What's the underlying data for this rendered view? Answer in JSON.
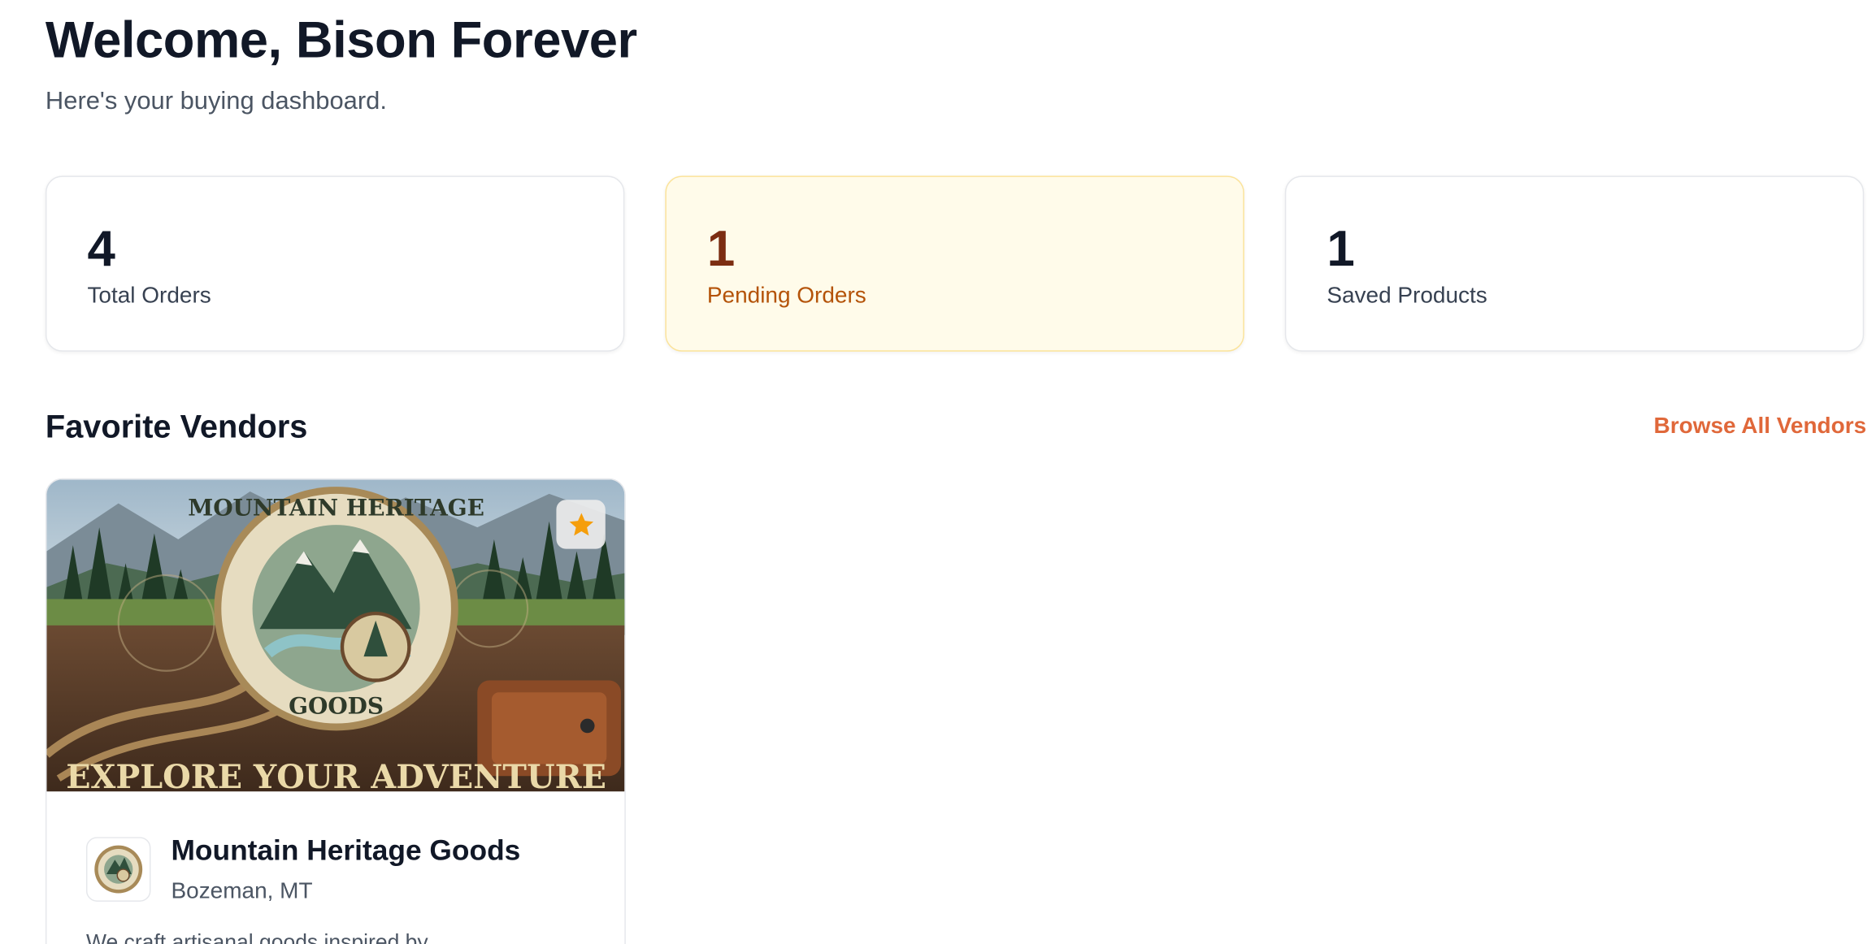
{
  "header": {
    "title": "Welcome, Bison Forever",
    "subtitle": "Here's your buying dashboard."
  },
  "stats": [
    {
      "value": "4",
      "label": "Total Orders"
    },
    {
      "value": "1",
      "label": "Pending Orders"
    },
    {
      "value": "1",
      "label": "Saved Products"
    }
  ],
  "favorites": {
    "title": "Favorite Vendors",
    "browse_label": "Browse All Vendors",
    "vendors": [
      {
        "name": "Mountain Heritage Goods",
        "location": "Bozeman, MT",
        "description": "We craft artisanal goods inspired by",
        "banner_tagline": "EXPLORE YOUR ADVENTURE",
        "badge_top_text": "MOUNTAIN HERITAGE",
        "badge_bottom_text": "GOODS",
        "favorite_icon": "star-icon"
      }
    ]
  },
  "colors": {
    "accent": "#e0683a",
    "pending_bg": "#fffbea",
    "pending_border": "#fbe39a",
    "star": "#f59e0b"
  }
}
